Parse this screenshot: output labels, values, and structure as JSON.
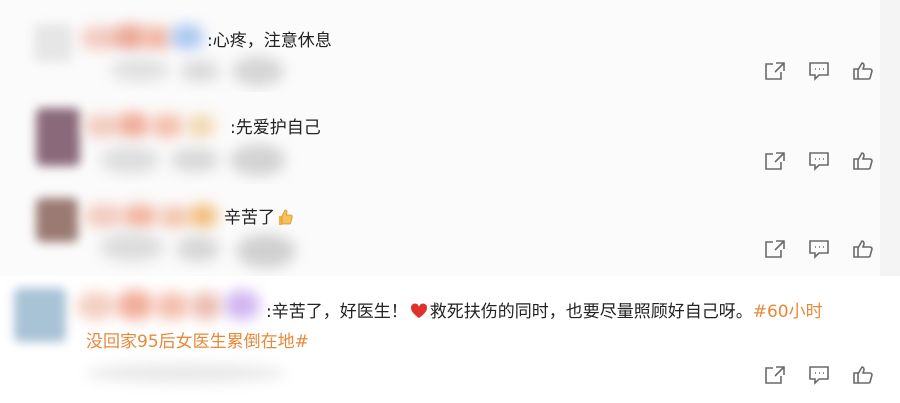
{
  "comments": [
    {
      "prefix": ":",
      "text": "心疼，注意休息"
    },
    {
      "prefix": ":",
      "text": "先爱护自己"
    },
    {
      "prefix": "",
      "text": "辛苦了"
    },
    {
      "prefix": ":",
      "text_before_heart": "辛苦了，好医生！",
      "text_after_heart": "救死扶伤的同时，也要尽量照顾好自己呀。",
      "hashtag_part1": "#60小时",
      "hashtag_part2": "没回家95后女医生累倒在地#"
    }
  ],
  "icons": {
    "share": "share-icon",
    "comment": "comment-icon",
    "like": "thumbs-up-icon",
    "heart_emoji": "heart-emoji-icon",
    "thumb_emoji": "thumbs-up-emoji-icon"
  },
  "colors": {
    "hashtag": "#e8883a",
    "heart": "#e0322c",
    "icon_stroke": "#6a6a6a"
  }
}
